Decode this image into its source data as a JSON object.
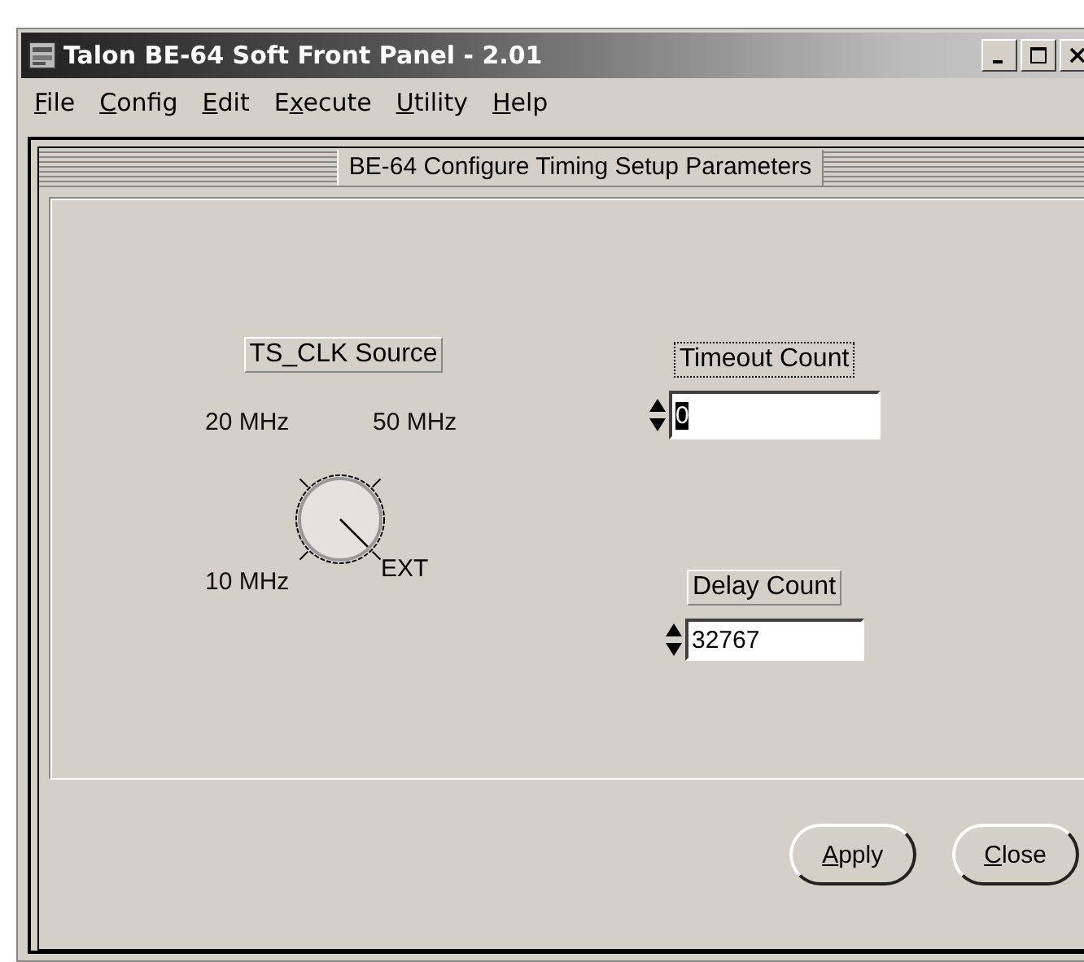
{
  "window": {
    "title": "Talon BE-64 Soft Front Panel - 2.01"
  },
  "menu": [
    {
      "key": "F",
      "after": "ile"
    },
    {
      "key": "C",
      "after": "onfig"
    },
    {
      "key": "E",
      "after": "dit"
    },
    {
      "before": "E",
      "key": "x",
      "after": "ecute"
    },
    {
      "key": "U",
      "after": "tility"
    },
    {
      "key": "H",
      "after": "elp"
    }
  ],
  "panel": {
    "title": "BE-64 Configure Timing Setup Parameters"
  },
  "knob": {
    "label": "TS_CLK Source",
    "options": [
      {
        "label": "20 MHz",
        "selected": false
      },
      {
        "label": "50 MHz",
        "selected": false
      },
      {
        "label": "10 MHz",
        "selected": false
      },
      {
        "label": "EXT",
        "selected": true
      }
    ]
  },
  "fields": [
    {
      "label": "Timeout Count",
      "value": "0",
      "focused": true
    },
    {
      "label": "Delay Count",
      "value": "32767",
      "focused": false
    }
  ],
  "buttons": [
    {
      "key": "A",
      "after": "pply"
    },
    {
      "key": "C",
      "after": "lose"
    }
  ]
}
